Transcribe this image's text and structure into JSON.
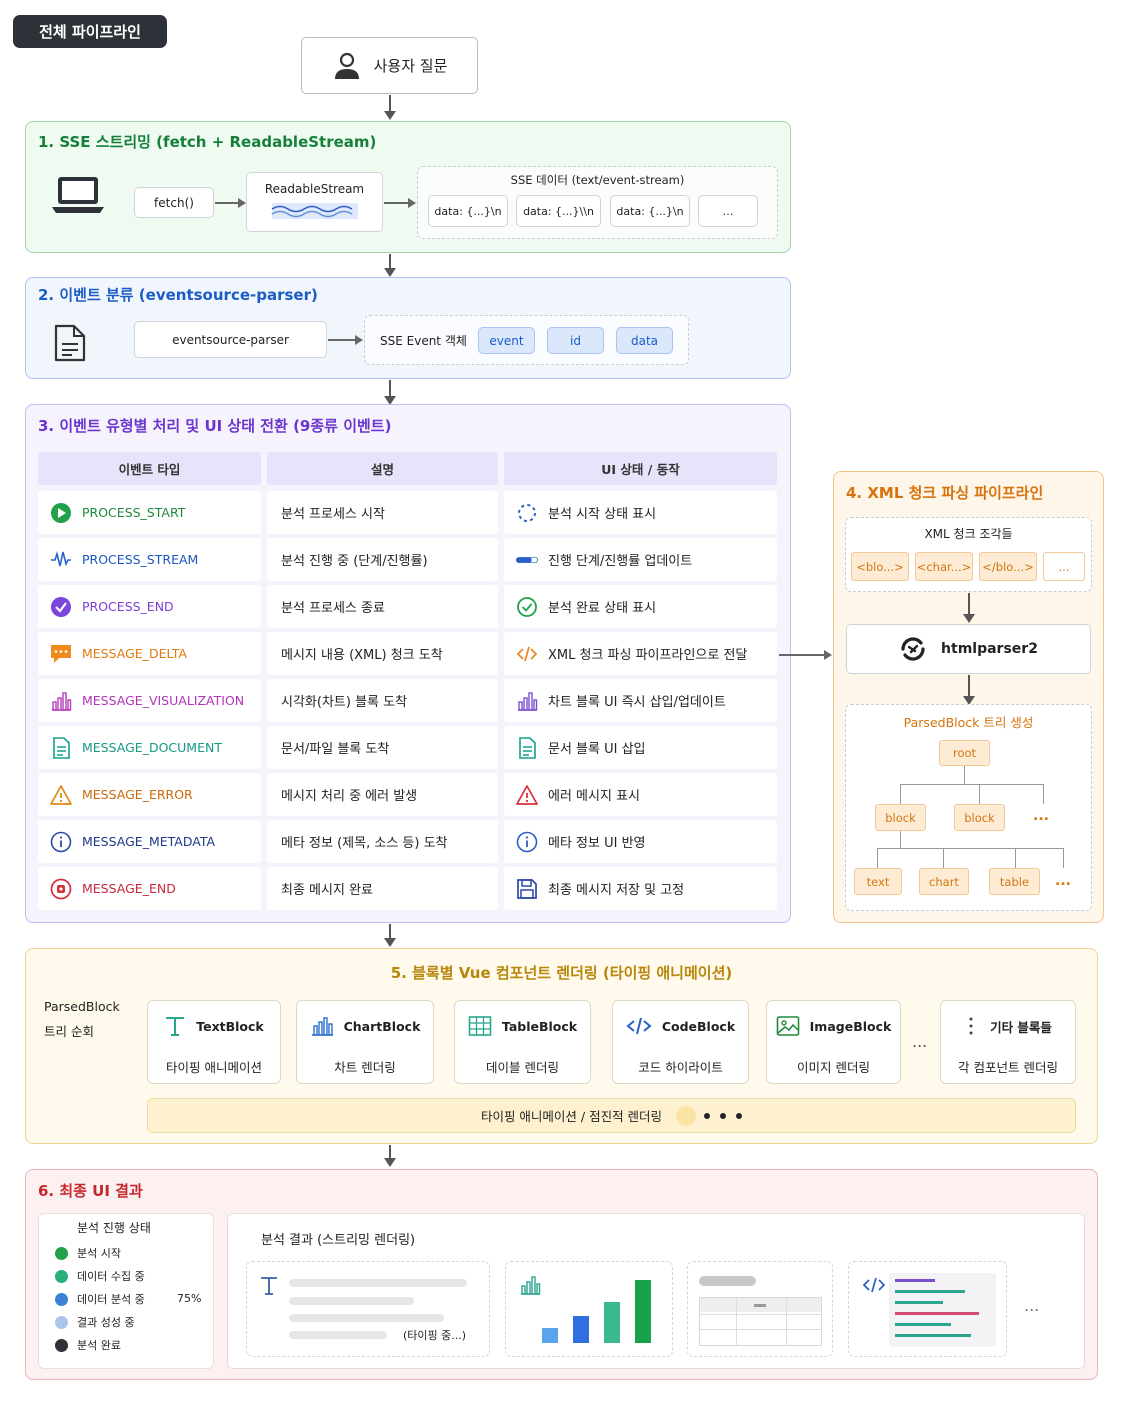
{
  "badge": "전체 파이프라인",
  "user_question": "사용자 질문",
  "section1": {
    "title": "1. SSE 스트리밍 (fetch + ReadableStream)",
    "fetch_label": "fetch()",
    "stream_label": "ReadableStream",
    "sse_data_title": "SSE 데이터 (text/event-stream)",
    "chunks": [
      "data: {...}\\n",
      "data: {...}\\\\n",
      "data: {...}\\n",
      "..."
    ]
  },
  "section2": {
    "title": "2. 이벤트 분류 (eventsource-parser)",
    "parser_label": "eventsource-parser",
    "event_obj_label": "SSE Event 객체",
    "fields": [
      "event",
      "id",
      "data"
    ]
  },
  "section3": {
    "title": "3. 이벤트 유형별 처리 및 UI 상태 전환 (9종류 이벤트)",
    "headers": [
      "이벤트 타입",
      "설명",
      "UI 상태 / 동작"
    ],
    "rows": [
      {
        "type": "PROCESS_START",
        "desc": "분석 프로세스 시작",
        "ui": "분석 시작 상태 표시",
        "color": "#1f8a3b"
      },
      {
        "type": "PROCESS_STREAM",
        "desc": "분석 진행 중 (단계/진행률)",
        "ui": "진행 단계/진행률 업데이트",
        "color": "#1a56c4"
      },
      {
        "type": "PROCESS_END",
        "desc": "분석 프로세스 종료",
        "ui": "분석 완료 상태 표시",
        "color": "#7b3fd6"
      },
      {
        "type": "MESSAGE_DELTA",
        "desc": "메시지 내용 (XML) 청크 도착",
        "ui": "XML 청크 파싱 파이프라인으로 전달",
        "color": "#e07b10"
      },
      {
        "type": "MESSAGE_VISUALIZATION",
        "desc": "시각화(차트) 블록 도착",
        "ui": "차트 블록 UI 즉시 삽입/업데이트",
        "color": "#b234b8"
      },
      {
        "type": "MESSAGE_DOCUMENT",
        "desc": "문서/파일 블록 도착",
        "ui": "문서 블록 UI 삽입",
        "color": "#159a86"
      },
      {
        "type": "MESSAGE_ERROR",
        "desc": "메시지 처리 중 에러 발생",
        "ui": "에러 메시지 표시",
        "color": "#c96a0c"
      },
      {
        "type": "MESSAGE_METADATA",
        "desc": "메타 정보 (제목, 소스 등) 도착",
        "ui": "메타 정보 UI 반영",
        "color": "#1e3a8a"
      },
      {
        "type": "MESSAGE_END",
        "desc": "최종 메시지 완료",
        "ui": "최종 메시지 저장 및 고정",
        "color": "#c7283b"
      }
    ]
  },
  "section4": {
    "title": "4. XML 청크 파싱 파이프라인",
    "chunks_title": "XML 청크 조각들",
    "chunks": [
      "<blo...>",
      "<char...>",
      "</blo...>",
      "..."
    ],
    "parser": "htmlparser2",
    "tree_title": "ParsedBlock 트리 생성",
    "root": "root",
    "blocks": [
      "block",
      "block",
      "..."
    ],
    "leaves": [
      "text",
      "chart",
      "table",
      "..."
    ]
  },
  "section5": {
    "title": "5. 블록별 Vue 컴포넌트 렌더링 (타이핑 애니메이션)",
    "left_label_1": "ParsedBlock",
    "left_label_2": "트리 순회",
    "components": [
      {
        "name": "TextBlock",
        "sub": "타이핑 애니메이션"
      },
      {
        "name": "ChartBlock",
        "sub": "차트 렌더링"
      },
      {
        "name": "TableBlock",
        "sub": "데이블 렌더링"
      },
      {
        "name": "CodeBlock",
        "sub": "코드 하이라이트"
      },
      {
        "name": "ImageBlock",
        "sub": "이미지 렌더링"
      },
      {
        "name": "기타 블록들",
        "sub": "각 컴포넌트 렌더링"
      }
    ],
    "ellipsis": "...",
    "bottom_bar": "타이핑 애니메이션 / 점진적 렌더링"
  },
  "section6": {
    "title": "6. 최종 UI 결과",
    "progress_title": "분석 진행 상태",
    "steps": [
      "분석 시작",
      "데이터 수집 중",
      "데이터 분석 중",
      "결과 성성 중",
      "분석 완료"
    ],
    "progress_percent": "75%",
    "result_title": "분석 결과 (스트리밍 렌더링)",
    "typing_label": "(타이핑 중...)",
    "ellipsis": "..."
  }
}
